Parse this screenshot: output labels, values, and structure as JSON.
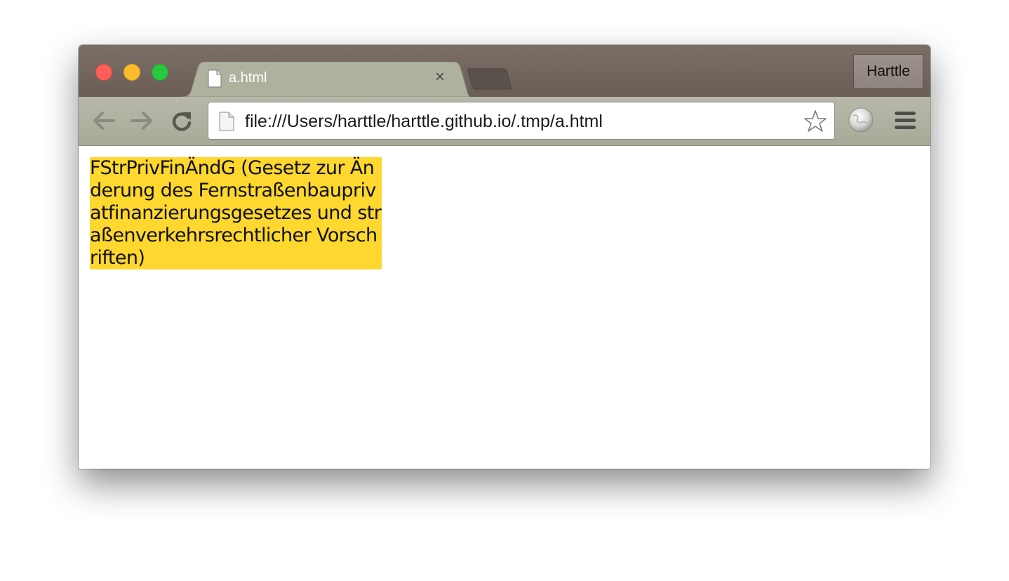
{
  "browser": {
    "profile_name": "Harttle",
    "tab": {
      "title": "a.html",
      "close_glyph": "×"
    },
    "address_bar": {
      "url": "file:///Users/harttle/harttle.github.io/.tmp/a.html"
    },
    "icons": {
      "close": "close-window-icon",
      "minimize": "minimize-window-icon",
      "maximize": "maximize-window-icon",
      "back": "back-arrow-icon",
      "forward": "forward-arrow-icon",
      "reload": "reload-icon",
      "page": "document-icon",
      "bookmark": "star-icon",
      "extension": "globe-icon",
      "menu": "hamburger-menu-icon"
    },
    "colors": {
      "titlebar": "#6f635b",
      "toolbar": "#b0b2a2",
      "highlight": "#fed72f"
    }
  },
  "page": {
    "text": "FStrPrivFinÄndG (Gesetz zur Änderung des Fernstraßenbauprivatfinanzierungsgesetzes und straßenverkehrsrechtlicher Vorschriften)"
  }
}
